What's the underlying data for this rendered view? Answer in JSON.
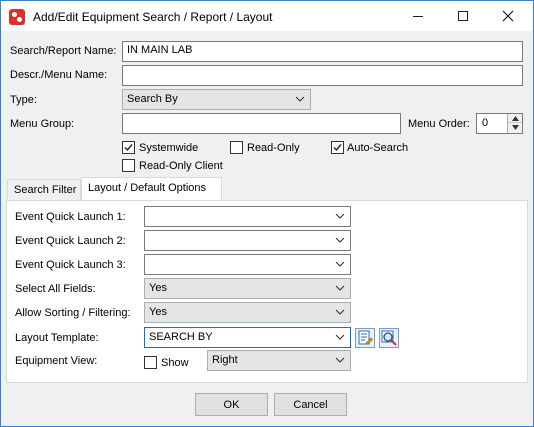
{
  "window": {
    "title": "Add/Edit Equipment Search / Report / Layout",
    "min_icon": "minimize-icon",
    "max_icon": "maximize-icon",
    "close_icon": "close-icon"
  },
  "form": {
    "search_report_name": {
      "label": "Search/Report Name:",
      "value": "IN MAIN LAB"
    },
    "descr_menu_name": {
      "label": "Descr./Menu Name:",
      "value": ""
    },
    "type": {
      "label": "Type:",
      "value": "Search By"
    },
    "menu_group": {
      "label": "Menu Group:",
      "value": ""
    },
    "menu_order": {
      "label": "Menu Order:",
      "value": "0"
    },
    "checkboxes": {
      "systemwide": {
        "label": "Systemwide",
        "checked": true
      },
      "read_only": {
        "label": "Read-Only",
        "checked": false
      },
      "auto_search": {
        "label": "Auto-Search",
        "checked": true
      },
      "read_only_client": {
        "label": "Read-Only Client",
        "checked": false
      }
    }
  },
  "tabs": [
    {
      "label": "Search Filter",
      "active": false
    },
    {
      "label": "Layout / Default Options",
      "active": true
    }
  ],
  "layout": {
    "event_quick_launch_1": {
      "label": "Event Quick Launch 1:",
      "value": ""
    },
    "event_quick_launch_2": {
      "label": "Event Quick Launch 2:",
      "value": ""
    },
    "event_quick_launch_3": {
      "label": "Event Quick Launch 3:",
      "value": ""
    },
    "select_all_fields": {
      "label": "Select All Fields:",
      "value": "Yes"
    },
    "allow_sorting": {
      "label": "Allow Sorting / Filtering:",
      "value": "Yes"
    },
    "layout_template": {
      "label": "Layout Template:",
      "value": "SEARCH BY"
    },
    "equipment_view": {
      "label": "Equipment View:",
      "show_label": "Show",
      "show_checked": false,
      "value": "Right"
    }
  },
  "buttons": {
    "ok": "OK",
    "cancel": "Cancel"
  },
  "colors": {
    "accent": "#0078d7",
    "titlebar": "#ffffff",
    "app_icon": "#d9342b"
  }
}
